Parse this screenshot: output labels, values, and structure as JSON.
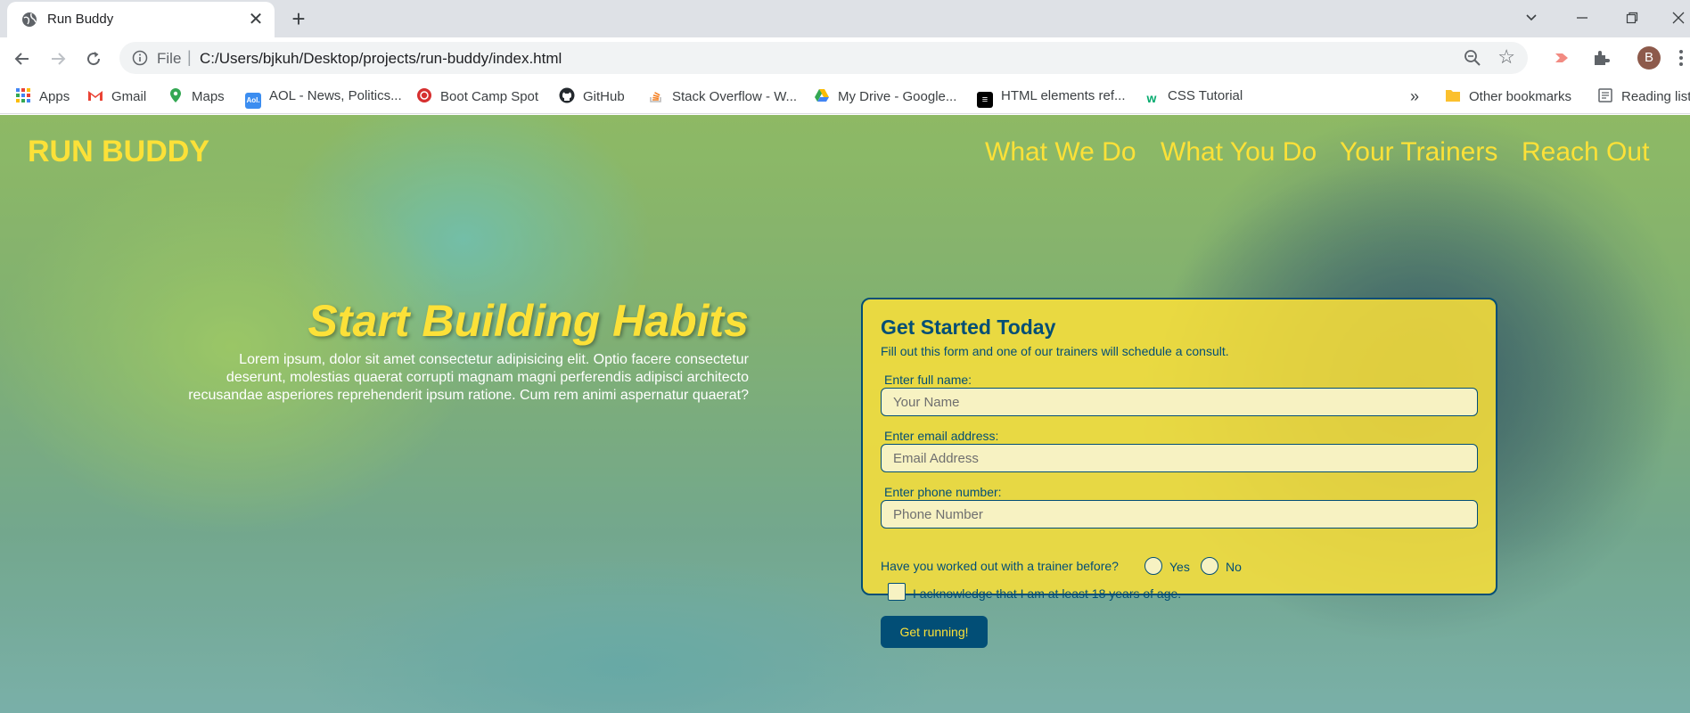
{
  "browser": {
    "tab_title": "Run Buddy",
    "tab_close": "✕",
    "new_tab": "+",
    "url_scheme": "File",
    "url_separator": "|",
    "url": "C:/Users/bjkuh/Desktop/projects/run-buddy/index.html",
    "profile_initial": "B",
    "bookmarks": [
      {
        "label": "Apps",
        "icon": "apps-grid-icon",
        "color": "#4285f4"
      },
      {
        "label": "Gmail",
        "icon": "gmail-icon",
        "color": "#ea4335"
      },
      {
        "label": "Maps",
        "icon": "maps-icon",
        "color": "#34a853"
      },
      {
        "label": "AOL - News, Politics...",
        "icon": "aol-icon",
        "color": "#3b8df0"
      },
      {
        "label": "Boot Camp Spot",
        "icon": "bootcamp-icon",
        "color": "#d62f2f"
      },
      {
        "label": "GitHub",
        "icon": "github-icon",
        "color": "#24292e"
      },
      {
        "label": "Stack Overflow - W...",
        "icon": "stackoverflow-icon",
        "color": "#f48024"
      },
      {
        "label": "My Drive - Google...",
        "icon": "google-drive-icon",
        "color": "#fbbc04"
      },
      {
        "label": "HTML elements ref...",
        "icon": "mdn-icon",
        "color": "#000000"
      },
      {
        "label": "CSS Tutorial",
        "icon": "w3schools-icon",
        "color": "#04aa6d"
      }
    ],
    "more_bookmarks": "»",
    "other_bookmarks": "Other bookmarks",
    "reading_list": "Reading list"
  },
  "page": {
    "logo": "RUN BUDDY",
    "nav": [
      "What We Do",
      "What You Do",
      "Your Trainers",
      "Reach Out"
    ],
    "hero_title": "Start Building Habits",
    "hero_text": "Lorem ipsum, dolor sit amet consectetur adipisicing elit. Optio facere consectetur deserunt, molestias quaerat corrupti magnam magni perferendis adipisci architecto recusandae asperiores reprehenderit ipsum ratione. Cum rem animi aspernatur quaerat?",
    "form": {
      "title": "Get Started Today",
      "subtitle": "Fill out this form and one of our trainers will schedule a consult.",
      "name_label": "Enter full name:",
      "name_placeholder": "Your Name",
      "email_label": "Enter email address:",
      "email_placeholder": "Email Address",
      "phone_label": "Enter phone number:",
      "phone_placeholder": "Phone Number",
      "trainer_question": "Have you worked out with a trainer before?",
      "yes_label": "Yes",
      "no_label": "No",
      "age_ack": "I acknowledge that I am at least 18 years of age.",
      "submit_label": "Get running!"
    },
    "colors": {
      "accent": "#fce138",
      "primary": "#024e76"
    }
  }
}
